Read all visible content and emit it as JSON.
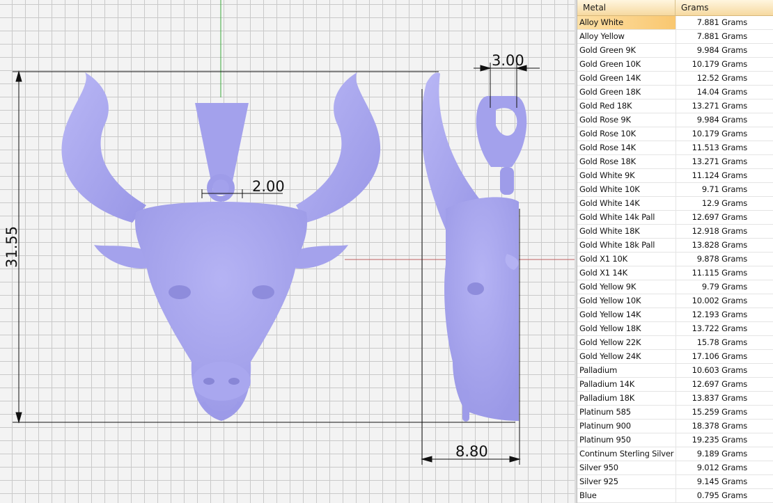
{
  "viewport": {
    "dimensions": {
      "height": "31.55",
      "width_side": "8.80",
      "bail_width": "3.00",
      "bail_diameter": "2.00"
    },
    "model": "bull-head-pendant",
    "model_color": "#a8a6ef",
    "grid_color": "#c9c9c9"
  },
  "table": {
    "headers": {
      "metal": "Metal",
      "grams": "Grams"
    },
    "selected_index": 0,
    "rows": [
      {
        "metal": "Alloy White",
        "grams": "7.881 Grams"
      },
      {
        "metal": "Alloy Yellow",
        "grams": "7.881 Grams"
      },
      {
        "metal": "Gold Green 9K",
        "grams": "9.984 Grams"
      },
      {
        "metal": "Gold Green 10K",
        "grams": "10.179 Grams"
      },
      {
        "metal": "Gold Green 14K",
        "grams": "12.52 Grams"
      },
      {
        "metal": "Gold Green 18K",
        "grams": "14.04 Grams"
      },
      {
        "metal": "Gold Red 18K",
        "grams": "13.271 Grams"
      },
      {
        "metal": "Gold Rose 9K",
        "grams": "9.984 Grams"
      },
      {
        "metal": "Gold Rose 10K",
        "grams": "10.179 Grams"
      },
      {
        "metal": "Gold Rose 14K",
        "grams": "11.513 Grams"
      },
      {
        "metal": "Gold Rose 18K",
        "grams": "13.271 Grams"
      },
      {
        "metal": "Gold White 9K",
        "grams": "11.124 Grams"
      },
      {
        "metal": "Gold White 10K",
        "grams": "9.71 Grams"
      },
      {
        "metal": "Gold White 14K",
        "grams": "12.9 Grams"
      },
      {
        "metal": "Gold White 14k Pall",
        "grams": "12.697 Grams"
      },
      {
        "metal": "Gold White 18K",
        "grams": "12.918 Grams"
      },
      {
        "metal": "Gold White 18k Pall",
        "grams": "13.828 Grams"
      },
      {
        "metal": "Gold X1 10K",
        "grams": "9.878 Grams"
      },
      {
        "metal": "Gold X1 14K",
        "grams": "11.115 Grams"
      },
      {
        "metal": "Gold Yellow 9K",
        "grams": "9.79 Grams"
      },
      {
        "metal": "Gold Yellow 10K",
        "grams": "10.002 Grams"
      },
      {
        "metal": "Gold Yellow 14K",
        "grams": "12.193 Grams"
      },
      {
        "metal": "Gold Yellow 18K",
        "grams": "13.722 Grams"
      },
      {
        "metal": "Gold Yellow 22K",
        "grams": "15.78 Grams"
      },
      {
        "metal": "Gold Yellow 24K",
        "grams": "17.106 Grams"
      },
      {
        "metal": "Palladium",
        "grams": "10.603 Grams"
      },
      {
        "metal": "Palladium 14K",
        "grams": "12.697 Grams"
      },
      {
        "metal": "Palladium 18K",
        "grams": "13.837 Grams"
      },
      {
        "metal": "Platinum 585",
        "grams": "15.259 Grams"
      },
      {
        "metal": "Platinum 900",
        "grams": "18.378 Grams"
      },
      {
        "metal": "Platinum 950",
        "grams": "19.235 Grams"
      },
      {
        "metal": "Continum Sterling Silver",
        "grams": "9.189 Grams"
      },
      {
        "metal": "Silver 950",
        "grams": "9.012 Grams"
      },
      {
        "metal": "Silver 925",
        "grams": "9.145 Grams"
      },
      {
        "metal": "Blue",
        "grams": "0.795 Grams"
      }
    ]
  }
}
